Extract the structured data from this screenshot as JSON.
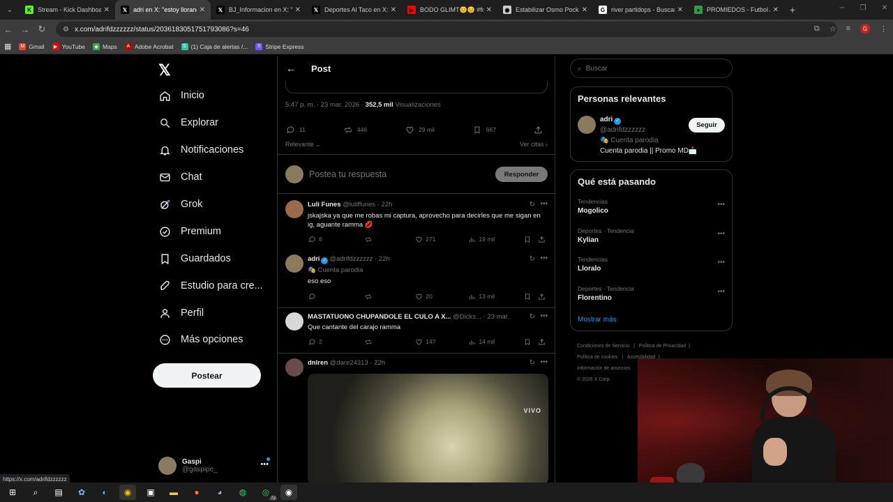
{
  "browser": {
    "tabs": [
      {
        "title": "Stream - Kick Dashboard",
        "icon": "kick-icon",
        "color": "#53fc18",
        "glyph": "K"
      },
      {
        "title": "adri en X: \"estoy llorando",
        "icon": "x-icon",
        "color": "#000000",
        "glyph": "𝕏"
      },
      {
        "title": "BJ_Informacion en X: \"",
        "icon": "x-icon",
        "color": "#000000",
        "glyph": "𝕏"
      },
      {
        "title": "Deportes Al Taco en X: \"",
        "icon": "x-icon",
        "color": "#000000",
        "glyph": "𝕏"
      },
      {
        "title": "BODO GLIMT😊😊 #foo",
        "icon": "youtube-icon",
        "color": "#ff0000",
        "glyph": "▶"
      },
      {
        "title": "Estabilizar Osmo Pocket",
        "icon": "page-icon",
        "color": "#cccccc",
        "glyph": "◉"
      },
      {
        "title": "river partidops - Buscar",
        "icon": "google-icon",
        "color": "#ffffff",
        "glyph": "G"
      },
      {
        "title": "PROMIEDOS - Futbol Arg",
        "icon": "promiedos-icon",
        "color": "#2e9e3e",
        "glyph": "●"
      }
    ],
    "url": "x.com/adrifdzzzzzz/status/2036183051751793086?s=46",
    "profile_initial": "G",
    "bookmarks": [
      {
        "label": "Gmail",
        "icon": "gmail-icon",
        "color": "#ea4335",
        "glyph": "M"
      },
      {
        "label": "YouTube",
        "icon": "youtube-icon",
        "color": "#ff0000",
        "glyph": "▶"
      },
      {
        "label": "Maps",
        "icon": "maps-icon",
        "color": "#34a853",
        "glyph": "◆"
      },
      {
        "label": "Adobe Acrobat",
        "icon": "acrobat-icon",
        "color": "#b30b00",
        "glyph": "A"
      },
      {
        "label": "(1) Caja de alertas /...",
        "icon": "streamlabs-icon",
        "color": "#31c3a2",
        "glyph": "S"
      },
      {
        "label": "Stripe Express",
        "icon": "stripe-icon",
        "color": "#635bff",
        "glyph": "S"
      }
    ],
    "status_url": "https://x.com/adrifdzzzzzz"
  },
  "leftnav": {
    "items": [
      {
        "label": "Inicio",
        "icon": "home-icon"
      },
      {
        "label": "Explorar",
        "icon": "search-icon"
      },
      {
        "label": "Notificaciones",
        "icon": "bell-icon"
      },
      {
        "label": "Chat",
        "icon": "mail-icon"
      },
      {
        "label": "Grok",
        "icon": "grok-icon"
      },
      {
        "label": "Premium",
        "icon": "verified-icon"
      },
      {
        "label": "Guardados",
        "icon": "bookmark-icon"
      },
      {
        "label": "Estudio para cre...",
        "icon": "rocket-icon"
      },
      {
        "label": "Perfil",
        "icon": "person-icon"
      },
      {
        "label": "Más opciones",
        "icon": "more-circle-icon"
      }
    ],
    "post_button": "Postear",
    "account": {
      "name": "Gaspi",
      "handle": "@gaspipe_"
    }
  },
  "post": {
    "header_title": "Post",
    "time": "5:47 p. m. · 23 mar. 2026 · ",
    "views_count": "352,5 mil",
    "views_label": " Visualizaciones",
    "replies": "11",
    "reposts": "446",
    "likes": "29 mil",
    "bookmarks": "667",
    "sort_label": "Relevante",
    "quotes_label": "Ver citas",
    "reply_placeholder": "Postea tu respuesta",
    "reply_button": "Responder"
  },
  "replies": [
    {
      "name": "Luli Funes",
      "handle": "@luliffunes",
      "time": "· 22h",
      "verified": false,
      "sub": "",
      "text": "jskajska ya que me robas mi captura, aprovecho para decirles que me sigan en ig, aguante ramma 💋",
      "replies": "6",
      "reposts": "",
      "likes": "271",
      "views": "19 mil",
      "avatar_color": "#9a6a4a"
    },
    {
      "name": "adri",
      "handle": "@adrifdzzzzzz",
      "time": "· 22h",
      "verified": true,
      "sub": "🎭 Cuenta parodia",
      "text": "eso eso",
      "replies": "",
      "reposts": "",
      "likes": "20",
      "views": "13 mil",
      "avatar_color": "#8a7a5e"
    },
    {
      "name": "MASTATUONO CHUPANDOLE EL CULO A X...",
      "handle": "@Dicks...",
      "time": "· 23 mar.",
      "verified": false,
      "sub": "",
      "text": "Que cantante del carajo ramma",
      "replies": "2",
      "reposts": "",
      "likes": "147",
      "views": "14 mil",
      "avatar_color": "#d8d8d8"
    },
    {
      "name": "dnlren",
      "handle": "@dare24313",
      "time": "· 22h",
      "verified": false,
      "sub": "",
      "text": "",
      "replies": "",
      "reposts": "",
      "likes": "",
      "views": "",
      "avatar_color": "#6a4a4a"
    }
  ],
  "media_overlay": "VIVO",
  "right": {
    "search_placeholder": "Buscar",
    "relevant_title": "Personas relevantes",
    "person": {
      "name": "adri",
      "handle": "@adrifdzzzzzz",
      "label": "🎭 Cuenta parodia",
      "bio": "Cuenta parodia || Promo MD📩",
      "follow": "Seguir"
    },
    "trending_title": "Qué está pasando",
    "trends": [
      {
        "category": "Tendencias",
        "name": "Mogolico"
      },
      {
        "category": "Deportes · Tendencia",
        "name": "Kylian"
      },
      {
        "category": "Tendencias",
        "name": "Lloralo"
      },
      {
        "category": "Deportes · Tendencia",
        "name": "Florentino"
      }
    ],
    "show_more": "Mostrar más",
    "footer": [
      "Condiciones de Servicio",
      "Política de Privacidad",
      "Política de cookies",
      "Accesibilidad",
      "Información de anuncios",
      "© 2026 X Corp."
    ]
  },
  "taskbar": {
    "whatsapp_badge": "72"
  },
  "colors": {
    "accent": "#1d9bf0",
    "background": "#000000",
    "border": "#2f3336",
    "muted": "#71767b"
  }
}
